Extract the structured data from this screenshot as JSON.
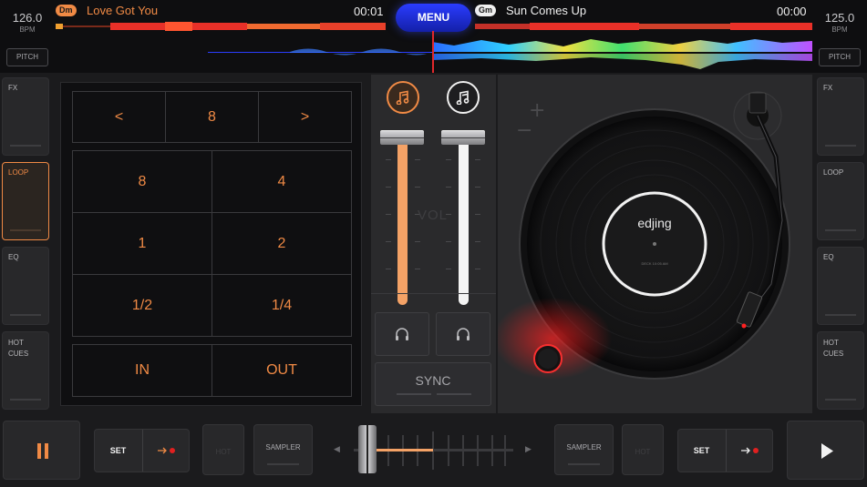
{
  "deck_left": {
    "bpm": "126.0",
    "bpm_unit": "BPM",
    "pitch_label": "PITCH",
    "key": "Dm",
    "title": "Love Got You",
    "time": "00:01"
  },
  "deck_right": {
    "bpm": "125.0",
    "bpm_unit": "BPM",
    "pitch_label": "PITCH",
    "key": "Gm",
    "title": "Sun Comes Up",
    "time": "00:00"
  },
  "menu_label": "MENU",
  "side_left": {
    "items": [
      {
        "label": "FX",
        "active": false
      },
      {
        "label": "LOOP",
        "active": true
      },
      {
        "label": "EQ",
        "active": false
      },
      {
        "label": "HOT CUES",
        "active": false
      }
    ]
  },
  "side_right": {
    "items": [
      {
        "label": "FX"
      },
      {
        "label": "LOOP"
      },
      {
        "label": "EQ"
      },
      {
        "label": "HOT CUES"
      }
    ]
  },
  "loop": {
    "prev": "<",
    "length": "8",
    "next": ">",
    "grid": [
      "8",
      "4",
      "1",
      "2",
      "1/2",
      "1/4"
    ],
    "in": "IN",
    "out": "OUT"
  },
  "mixer": {
    "vol_label": "VOL",
    "sync_label": "SYNC",
    "left_volume": 0.97,
    "right_volume": 0.97,
    "note_icon_left": "music-note-icon",
    "note_icon_right": "music-note-icon",
    "headphone_icon": "headphones-icon"
  },
  "turntable": {
    "brand": "edjing",
    "label_small": "DECK 10:05 AM",
    "minus": "−",
    "plus": "+"
  },
  "bottom": {
    "left": {
      "set": "SET",
      "hot_dim": "HOT",
      "sampler": "SAMPLER"
    },
    "right": {
      "set": "SET",
      "hot_dim": "HOT",
      "sampler": "SAMPLER"
    },
    "crossfader_arrow_left": "◀",
    "crossfader_arrow_right": "▶",
    "crossfader_position": 0.03
  },
  "colors": {
    "accent": "#f08a45",
    "menu": "#2a3cff",
    "playhead": "#e0282b"
  }
}
